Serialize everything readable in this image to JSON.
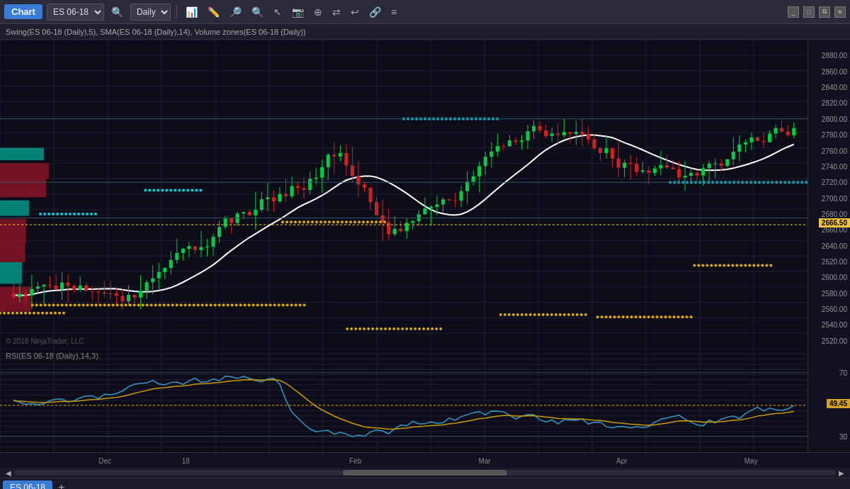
{
  "titlebar": {
    "chart_label": "Chart",
    "symbol": "ES 06-18",
    "period": "Daily",
    "icons": [
      "search",
      "bar-chart",
      "pencil",
      "zoom-in",
      "zoom-out",
      "cursor",
      "screenshot",
      "crosshair",
      "sync",
      "replay",
      "settings"
    ]
  },
  "subtitle": {
    "text": "Swing(ES 06-18 (Daily),5), SMA(ES 06-18 (Daily),14), Volume zones(ES 06-18 (Daily))"
  },
  "main_chart": {
    "price_levels": [
      {
        "price": "2880.00",
        "pct": 2
      },
      {
        "price": "2860.00",
        "pct": 6
      },
      {
        "price": "2840.00",
        "pct": 10
      },
      {
        "price": "2820.00",
        "pct": 14
      },
      {
        "price": "2800.00",
        "pct": 18
      },
      {
        "price": "2780.00",
        "pct": 22
      },
      {
        "price": "2760.00",
        "pct": 26
      },
      {
        "price": "2740.00",
        "pct": 30
      },
      {
        "price": "2720.00",
        "pct": 34
      },
      {
        "price": "2700.00",
        "pct": 38
      },
      {
        "price": "2680.00",
        "pct": 42
      },
      {
        "price": "2660.00",
        "pct": 46
      },
      {
        "price": "2640.00",
        "pct": 50
      },
      {
        "price": "2620.00",
        "pct": 54
      },
      {
        "price": "2600.00",
        "pct": 58
      },
      {
        "price": "2580.00",
        "pct": 62
      },
      {
        "price": "2560.00",
        "pct": 66
      },
      {
        "price": "2540.00",
        "pct": 70
      },
      {
        "price": "2520.00",
        "pct": 74
      }
    ],
    "current_price": "2666.50",
    "current_price_pct": 45
  },
  "rsi_chart": {
    "label": "RSI(ES 06-18 (Daily),14,3)",
    "levels": [
      {
        "val": "70",
        "pct": 20
      },
      {
        "val": "30",
        "pct": 80
      }
    ],
    "current_value": "49.45",
    "current_pct": 50
  },
  "date_axis": {
    "labels": [
      {
        "text": "Dec",
        "pct": 13
      },
      {
        "text": "18",
        "pct": 23
      },
      {
        "text": "Feb",
        "pct": 44
      },
      {
        "text": "Mar",
        "pct": 60
      },
      {
        "text": "Apr",
        "pct": 77
      },
      {
        "text": "May",
        "pct": 93
      }
    ]
  },
  "tab": {
    "name": "ES 06-18"
  },
  "copyright": "© 2018 NinjaTrader, LLC"
}
